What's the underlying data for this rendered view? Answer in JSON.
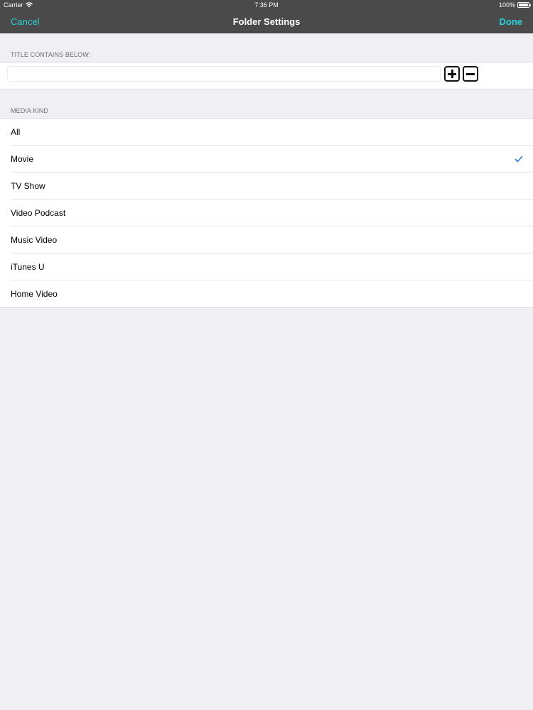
{
  "status_bar": {
    "carrier": "Carrier",
    "time": "7:36 PM",
    "battery": "100%",
    "icons": [
      "wifi-icon",
      "battery-icon"
    ]
  },
  "nav": {
    "cancel_label": "Cancel",
    "title": "Folder Settings",
    "done_label": "Done",
    "accent_color": "#2bd0dc",
    "bar_color": "#4a4a4a"
  },
  "title_section": {
    "header": "TITLE CONTAINS BELOW:",
    "input_value": "",
    "add_icon": "plus-square-icon",
    "remove_icon": "minus-square-icon"
  },
  "media_kind": {
    "header": "MEDIA KIND",
    "selected": "Movie",
    "check_color": "#2a7fd6",
    "items": [
      {
        "label": "All",
        "checked": false
      },
      {
        "label": "Movie",
        "checked": true
      },
      {
        "label": "TV Show",
        "checked": false
      },
      {
        "label": "Video Podcast",
        "checked": false
      },
      {
        "label": "Music Video",
        "checked": false
      },
      {
        "label": "iTunes U",
        "checked": false
      },
      {
        "label": "Home Video",
        "checked": false
      }
    ]
  }
}
